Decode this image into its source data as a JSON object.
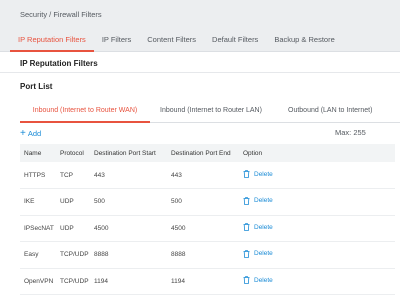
{
  "breadcrumb": "Security / Firewall Filters",
  "tabs": [
    "IP Reputation Filters",
    "IP Filters",
    "Content Filters",
    "Default Filters",
    "Backup & Restore"
  ],
  "section_title": "IP Reputation Filters",
  "port_list_title": "Port List",
  "subtabs": [
    "Inbound (Internet to Router WAN)",
    "Inbound (Internet to Router LAN)",
    "Outbound (LAN to Internet)"
  ],
  "add_label": "Add",
  "max_label": "Max: 255",
  "table": {
    "headers": [
      "Name",
      "Protocol",
      "Destination Port Start",
      "Destination Port End",
      "Option"
    ],
    "rows": [
      {
        "name": "HTTPS",
        "protocol": "TCP",
        "start": "443",
        "end": "443",
        "option": "Delete"
      },
      {
        "name": "IKE",
        "protocol": "UDP",
        "start": "500",
        "end": "500",
        "option": "Delete"
      },
      {
        "name": "IPSecNAT",
        "protocol": "UDP",
        "start": "4500",
        "end": "4500",
        "option": "Delete"
      },
      {
        "name": "Easy",
        "protocol": "TCP/UDP",
        "start": "8888",
        "end": "8888",
        "option": "Delete"
      },
      {
        "name": "OpenVPN",
        "protocol": "TCP/UDP",
        "start": "1194",
        "end": "1194",
        "option": "Delete"
      }
    ]
  },
  "colors": {
    "accent": "#e8533f",
    "link": "#1a8bd6",
    "header_bg": "#eceef0"
  },
  "icons": {
    "add": "plus-icon",
    "delete": "trash-icon"
  }
}
